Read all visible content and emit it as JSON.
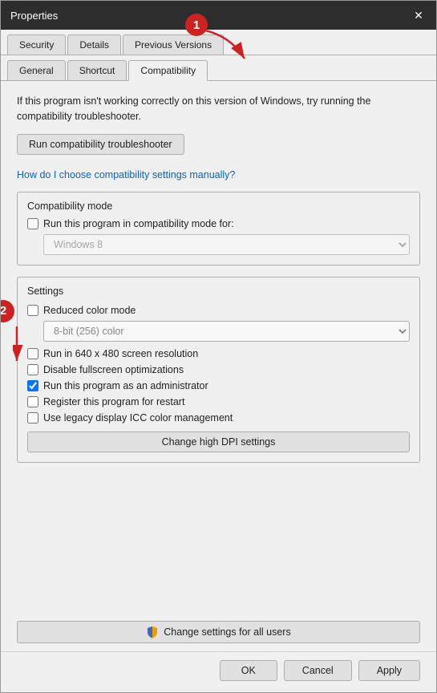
{
  "window": {
    "title": "Properties",
    "close_label": "✕"
  },
  "tabs": {
    "row1": [
      "Security",
      "Details",
      "Previous Versions"
    ],
    "row2": [
      "General",
      "Shortcut",
      "Compatibility"
    ],
    "active": "Compatibility"
  },
  "info_text": "If this program isn't working correctly on this version of Windows, try running the compatibility troubleshooter.",
  "run_troubleshooter_btn": "Run compatibility troubleshooter",
  "how_to_link": "How do I choose compatibility settings manually?",
  "compatibility_mode": {
    "label": "Compatibility mode",
    "checkbox_label": "Run this program in compatibility mode for:",
    "dropdown_value": "Windows 8",
    "checked": false
  },
  "settings": {
    "label": "Settings",
    "items": [
      {
        "label": "Reduced color mode",
        "checked": false
      },
      {
        "label": "Run in 640 x 480 screen resolution",
        "checked": false
      },
      {
        "label": "Disable fullscreen optimizations",
        "checked": false
      },
      {
        "label": "Run this program as an administrator",
        "checked": true
      },
      {
        "label": "Register this program for restart",
        "checked": false
      },
      {
        "label": "Use legacy display ICC color management",
        "checked": false
      }
    ],
    "color_dropdown": "8-bit (256) color",
    "change_dpi_btn": "Change high DPI settings"
  },
  "change_all_btn": "Change settings for all users",
  "footer": {
    "ok": "OK",
    "cancel": "Cancel",
    "apply": "Apply"
  },
  "annotations": {
    "one": "1",
    "two": "2"
  }
}
